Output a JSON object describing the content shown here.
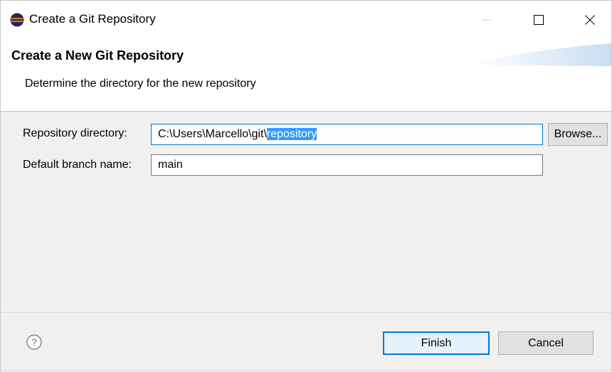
{
  "window": {
    "title": "Create a Git Repository"
  },
  "header": {
    "title": "Create a New Git Repository",
    "message": "Determine the directory for the new repository"
  },
  "form": {
    "repo_dir_label": "Repository directory:",
    "repo_dir_prefix": "C:\\Users\\Marcello\\git\\",
    "repo_dir_selected": "repository",
    "browse_label": "Browse...",
    "branch_label": "Default branch name:",
    "branch_value": "main"
  },
  "buttons": {
    "finish": "Finish",
    "cancel": "Cancel"
  },
  "colors": {
    "selection": "#3399ff",
    "focus_border": "#0078d7"
  },
  "icons": [
    "eclipse-logo-icon",
    "minimize-icon",
    "maximize-icon",
    "close-icon",
    "help-icon"
  ]
}
